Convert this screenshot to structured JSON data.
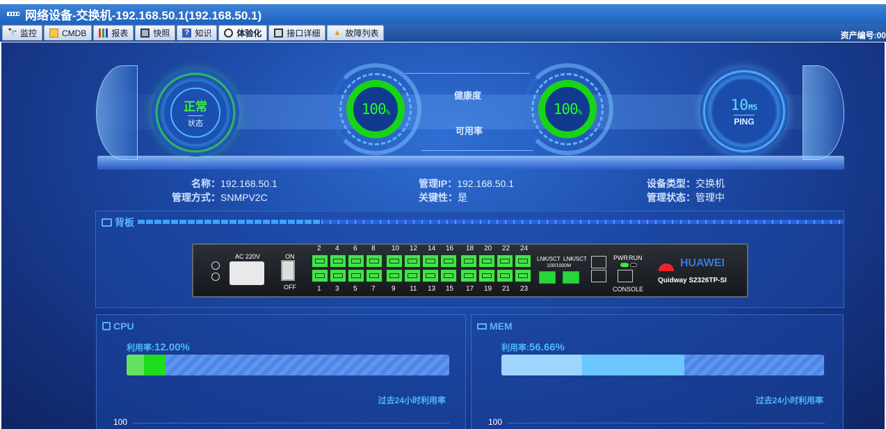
{
  "window": {
    "title": "网络设备-交换机-192.168.50.1(192.168.50.1)"
  },
  "tabs": [
    {
      "label": "监控",
      "icon": "binoculars-icon"
    },
    {
      "label": "CMDB",
      "icon": "document-icon"
    },
    {
      "label": "报表",
      "icon": "bar-chart-icon"
    },
    {
      "label": "快照",
      "icon": "monitor-icon"
    },
    {
      "label": "知识",
      "icon": "help-book-icon"
    },
    {
      "label": "体验化",
      "icon": "dashboard-icon",
      "active": true
    },
    {
      "label": "接口详细",
      "icon": "screen-icon"
    },
    {
      "label": "故障列表",
      "icon": "warning-icon"
    }
  ],
  "asset_label": "资产编号:00",
  "hero": {
    "status_value": "正常",
    "status_label": "状态",
    "health_value": "100",
    "health_unit": "%",
    "health_label": "健康度",
    "avail_value": "100",
    "avail_unit": "%",
    "avail_label": "可用率",
    "ping_value": "10",
    "ping_unit": "MS",
    "ping_label": "PING"
  },
  "info": {
    "name_k": "名称：",
    "name_v": "192.168.50.1",
    "mgmt_ip_k": "管理IP：",
    "mgmt_ip_v": "192.168.50.1",
    "type_k": "设备类型：",
    "type_v": "交换机",
    "mgmt_method_k": "管理方式：",
    "mgmt_method_v": "SNMPV2C",
    "key_k": "关键性：",
    "key_v": "是",
    "mgmt_state_k": "管理状态：",
    "mgmt_state_v": "管理中"
  },
  "backplane": {
    "title": "背板",
    "power_label": "AC 220V",
    "on_label": "ON",
    "off_label": "OFF",
    "top_ports": [
      "2",
      "4",
      "6",
      "8",
      "10",
      "12",
      "14",
      "16",
      "18",
      "20",
      "22",
      "24"
    ],
    "bottom_ports": [
      "1",
      "3",
      "5",
      "7",
      "9",
      "11",
      "13",
      "15",
      "17",
      "19",
      "21",
      "23"
    ],
    "lnk_label1": "LNK/SCT",
    "lnk_label2": "LNK/SCT",
    "speed_label": "100/1000M",
    "pwr_label": "PWR",
    "run_label": "RUN",
    "console_label": "CONSOLE",
    "brand": "HUAWEI",
    "model": "Quidway S2326TP-SI"
  },
  "cpu": {
    "title": "CPU",
    "util_prefix": "利用率:",
    "util_value": "12.00%",
    "util_fraction": 0.12,
    "past_label": "过去24小时利用率",
    "axis_top": "100"
  },
  "mem": {
    "title": "MEM",
    "util_prefix": "利用率:",
    "util_value": "56.66%",
    "util_fraction": 0.5666,
    "past_label": "过去24小时利用率",
    "axis_top": "100"
  }
}
